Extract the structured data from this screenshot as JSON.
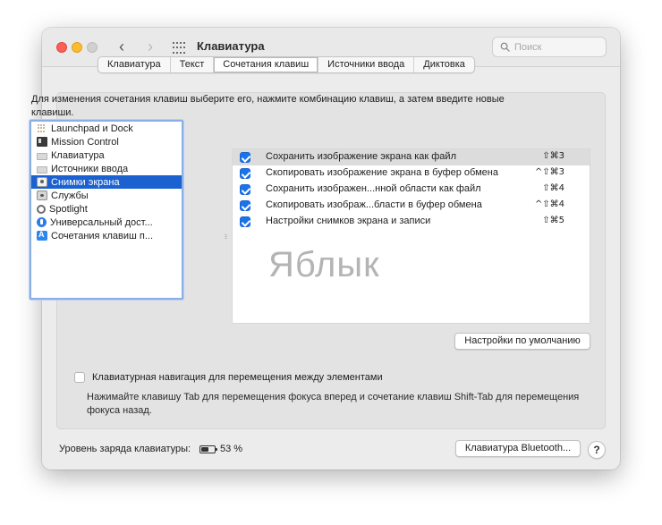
{
  "window": {
    "title": "Клавиатура",
    "search_placeholder": "Поиск"
  },
  "tabs": [
    {
      "label": "Клавиатура",
      "active": false
    },
    {
      "label": "Текст",
      "active": false
    },
    {
      "label": "Сочетания клавиш",
      "active": true
    },
    {
      "label": "Источники ввода",
      "active": false
    },
    {
      "label": "Диктовка",
      "active": false
    }
  ],
  "instructions": "Для изменения сочетания клавиш выберите его, нажмите комбинацию клавиш, а затем введите новые клавиши.",
  "sidebar": {
    "items": [
      {
        "label": "Launchpad и Dock",
        "icon": "launchpad-icon"
      },
      {
        "label": "Mission Control",
        "icon": "mission-control-icon"
      },
      {
        "label": "Клавиатура",
        "icon": "keyboard-icon"
      },
      {
        "label": "Источники ввода",
        "icon": "keyboard-icon"
      },
      {
        "label": "Снимки экрана",
        "icon": "screenshot-icon",
        "selected": true
      },
      {
        "label": "Службы",
        "icon": "services-icon"
      },
      {
        "label": "Spotlight",
        "icon": "spotlight-icon"
      },
      {
        "label": "Универсальный дост...",
        "icon": "accessibility-icon"
      },
      {
        "label": "Сочетания клавиш п...",
        "icon": "app-store-icon"
      }
    ]
  },
  "shortcuts": [
    {
      "label": "Сохранить изображение экрана как файл",
      "keys": "⇧⌘3",
      "checked": true,
      "highlight": true
    },
    {
      "label": "Скопировать изображение экрана в буфер обмена",
      "keys": "^⇧⌘3",
      "checked": true
    },
    {
      "label": "Сохранить изображен...нной области как файл",
      "keys": "⇧⌘4",
      "checked": true
    },
    {
      "label": "Скопировать изображ...бласти в буфер обмена",
      "keys": "^⇧⌘4",
      "checked": true
    },
    {
      "label": "Настройки снимков экрана и записи",
      "keys": "⇧⌘5",
      "checked": true
    }
  ],
  "watermark": "Яблык",
  "buttons": {
    "defaults": "Настройки по умолчанию",
    "bluetooth": "Клавиатура Bluetooth...",
    "help": "?"
  },
  "keyboard_nav": {
    "label": "Клавиатурная навигация для перемещения между элементами",
    "hint": "Нажимайте клавишу Tab для перемещения фокуса вперед и сочетание клавиш Shift-Tab для перемещения фокуса назад.",
    "checked": false
  },
  "battery": {
    "label": "Уровень заряда клавиатуры:",
    "value": "53 %",
    "level_fraction": 0.53
  },
  "colors": {
    "accent": "#1b61d0",
    "checkbox": "#1a73e8",
    "close": "#fc5f57",
    "minimize": "#fdbc2e"
  }
}
